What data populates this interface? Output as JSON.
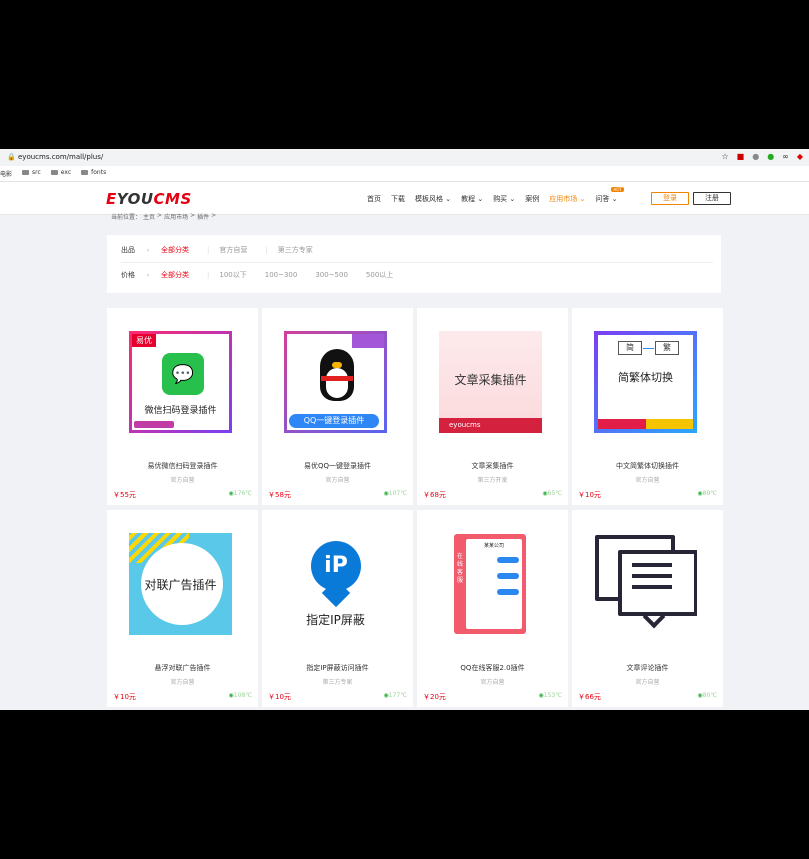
{
  "browser": {
    "url": "eyoucms.com/mall/plus/",
    "bookmarks": [
      "电影",
      "src",
      "exc",
      "fonts"
    ]
  },
  "site": {
    "logo": {
      "part1": "E",
      "part2": "YOU",
      "part3": "CMS"
    },
    "nav": [
      "首页",
      "下载",
      "模板风格 ⌄",
      "教程 ⌄",
      "购买 ⌄",
      "案例",
      "应用市场 ⌄",
      "问答 ⌄"
    ],
    "hot_badge": "HOT",
    "login": "登录",
    "register": "注册"
  },
  "breadcrumb": [
    "当前位置：",
    "主页",
    ">",
    "应用市场",
    ">",
    "插件",
    ">"
  ],
  "filter": {
    "source": {
      "label": "出品",
      "options": [
        "全部分类",
        "官方自营",
        "第三方专家"
      ]
    },
    "price": {
      "label": "价格",
      "options": [
        "全部分类",
        "100以下",
        "100~300",
        "300~500",
        "500以上"
      ]
    }
  },
  "products": [
    {
      "name": "易优微信扫码登录插件",
      "vendor": "官方自营",
      "price": "￥55元",
      "views": "176℃",
      "thumb_text": "微信扫码登录插件",
      "tag": "易优"
    },
    {
      "name": "易优QQ一键登录插件",
      "vendor": "官方自营",
      "price": "￥58元",
      "views": "107℃",
      "thumb_text": "QQ一键登录插件"
    },
    {
      "name": "文章采集插件",
      "vendor": "第三方开发",
      "price": "￥68元",
      "views": "65℃",
      "thumb_text": "文章采集插件",
      "brand": "eyoucms"
    },
    {
      "name": "中文简繁体切换插件",
      "vendor": "官方自营",
      "price": "￥10元",
      "views": "89℃",
      "thumb_text": "简繁体切换",
      "simp": "简",
      "trad": "繁"
    },
    {
      "name": "悬浮对联广告插件",
      "vendor": "官方自营",
      "price": "￥10元",
      "views": "108℃",
      "thumb_text": "对联广告插件"
    },
    {
      "name": "指定IP屏蔽访问插件",
      "vendor": "第三方专家",
      "price": "￥10元",
      "views": "177℃",
      "thumb_text": "指定IP屏蔽",
      "ip": "iP"
    },
    {
      "name": "QQ在线客服2.0插件",
      "vendor": "官方自营",
      "price": "￥20元",
      "views": "153℃",
      "thumb_text": "在线客服",
      "company": "某某公司"
    },
    {
      "name": "文章评论插件",
      "vendor": "官方自营",
      "price": "￥66元",
      "views": "80℃"
    }
  ],
  "colors": {
    "brand": "#e60012",
    "accent": "#f08300",
    "views": "#3bb34a"
  }
}
